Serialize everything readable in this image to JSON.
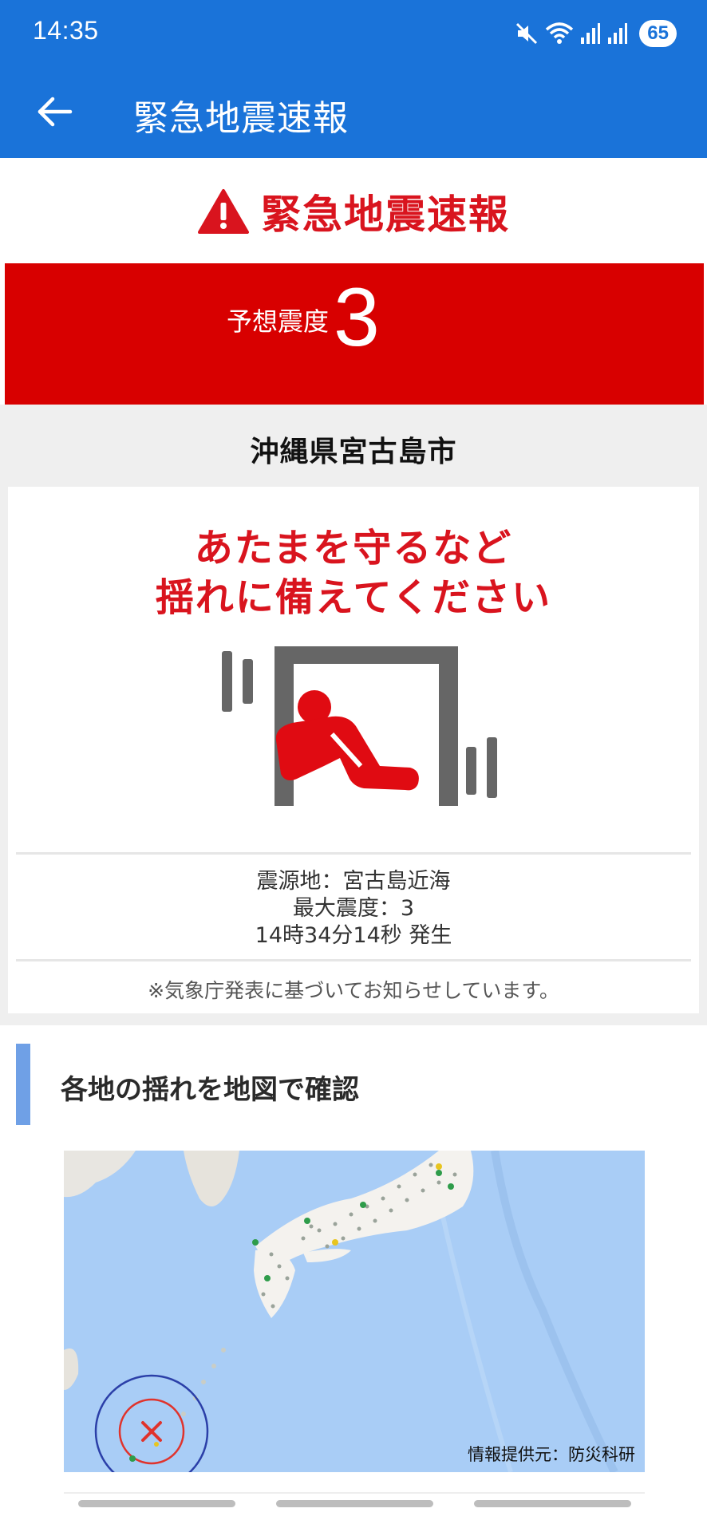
{
  "status_bar": {
    "time": "14:35",
    "battery": "65",
    "icons": [
      "mute-icon",
      "wifi-icon",
      "signal-icon",
      "signal-icon"
    ]
  },
  "app_bar": {
    "title": "緊急地震速報",
    "back_icon": "arrow-back-icon"
  },
  "alert": {
    "heading": "緊急地震速報",
    "heading_icon": "warning-triangle-icon",
    "intensity_label": "予想震度",
    "intensity_value": "3",
    "band_color": "#d80000",
    "region": "沖縄県宮古島市",
    "advice_line1": "あたまを守るなど",
    "advice_line2": "揺れに備えてください",
    "pictogram": "take-cover-under-table-icon",
    "epicenter": "震源地：宮古島近海",
    "max_intensity": "最大震度：3",
    "occurred_at": "14時34分14秒 発生",
    "note": "※気象庁発表に基づいてお知らせしています。"
  },
  "map_section": {
    "title": "各地の揺れを地図で確認",
    "credit": "情報提供元：防災科研"
  },
  "colors": {
    "app_bar": "#1a73d9",
    "alert_red": "#d9141e",
    "map_sea": "#a9cdf6"
  }
}
